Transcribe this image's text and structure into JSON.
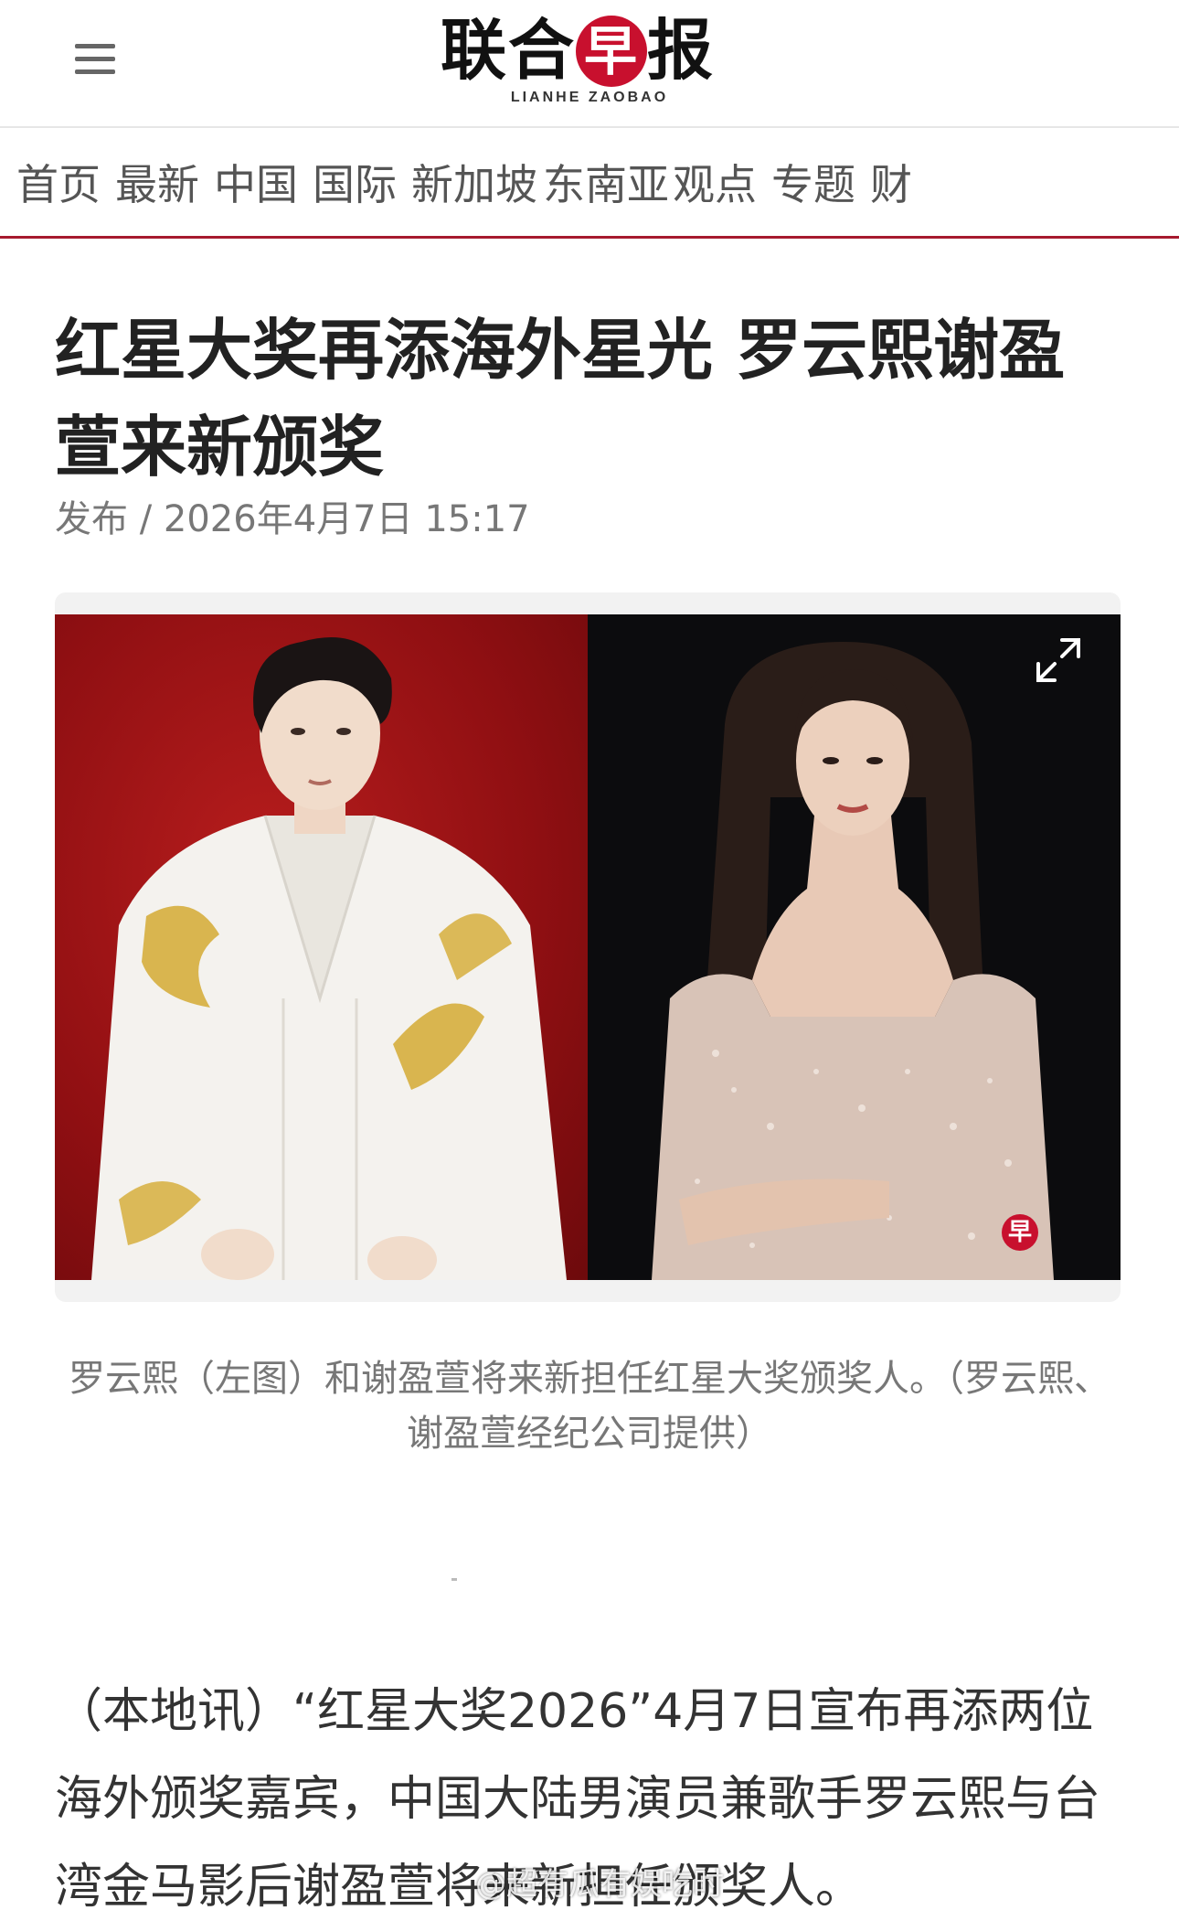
{
  "header": {
    "logo_cn": "联合早报",
    "logo_cn_pre": "联合",
    "logo_cn_zao": "早",
    "logo_cn_post": "报",
    "logo_en": "LIANHE ZAOBAO",
    "menu_icon": "hamburger-icon"
  },
  "nav": {
    "items": [
      "首页",
      "最新",
      "中国",
      "国际",
      "新加坡",
      "东南亚",
      "观点",
      "专题",
      "财"
    ]
  },
  "article": {
    "headline": "红星大奖再添海外星光 罗云熙谢盈萱来新颁奖",
    "publish": "发布 / 2026年4月7日 15:17",
    "image": {
      "left_subject": "man in white embroidered robe on red background",
      "right_subject": "woman in sequined dress on black background",
      "expand_icon": "expand-icon",
      "watermark": "早"
    },
    "caption": "罗云熙（左图）和谢盈萱将来新担任红星大奖颁奖人。（罗云熙、谢盈萱经纪公司提供）",
    "body": "（本地讯）“红星大奖2026”4月7日宣布再添两位海外颁奖嘉宾，中国大陆男演员兼歌手罗云熙与台湾金马影后谢盈萱将来新担任颁奖人。"
  },
  "overlay": {
    "weibo_watermark": "@超有瓜有娱吃时"
  },
  "colors": {
    "brand_red": "#c8102e",
    "nav_border": "#a6192e",
    "text_dark": "#222222",
    "text_muted": "#777777"
  }
}
